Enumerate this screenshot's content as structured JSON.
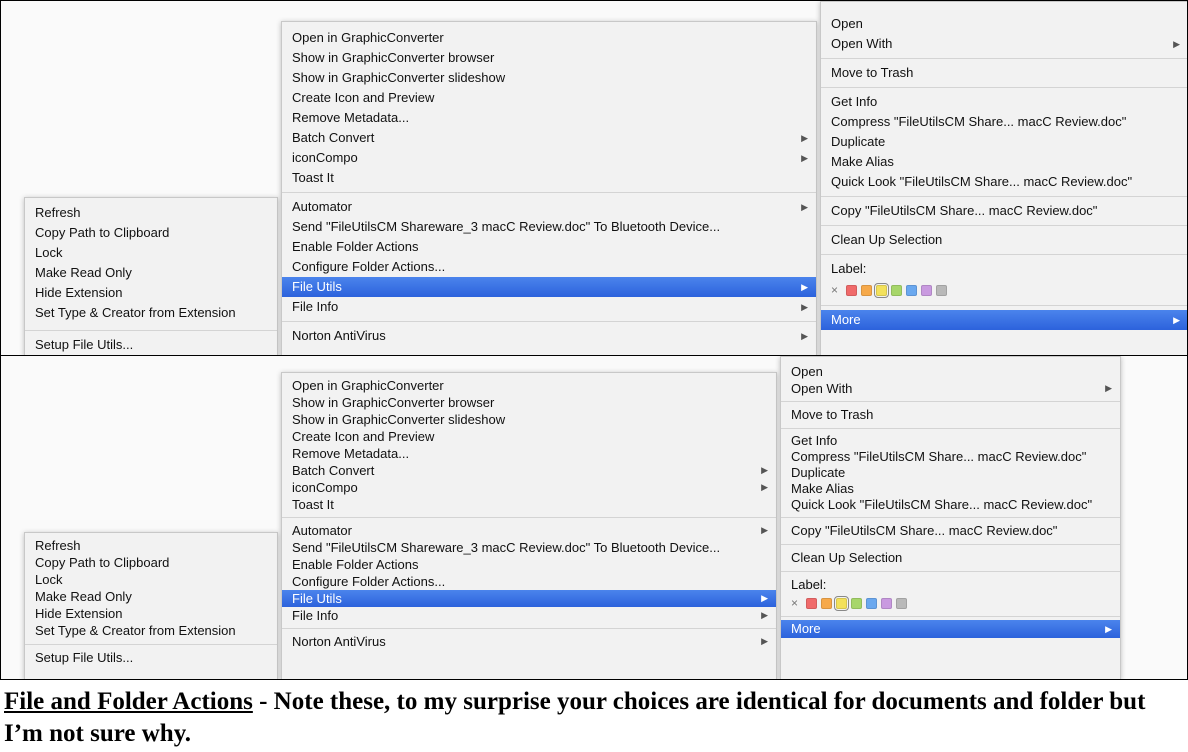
{
  "col1": {
    "items": [
      {
        "label": "Refresh"
      },
      {
        "label": "Copy Path to Clipboard"
      },
      {
        "label": "Lock"
      },
      {
        "label": "Make Read Only"
      },
      {
        "label": "Hide Extension"
      },
      {
        "label": "Set Type & Creator from Extension"
      }
    ],
    "setup": "Setup File Utils..."
  },
  "col2": {
    "group1": [
      {
        "label": "Open in GraphicConverter",
        "arrow": false
      },
      {
        "label": "Show in GraphicConverter browser",
        "arrow": false
      },
      {
        "label": "Show in GraphicConverter slideshow",
        "arrow": false
      },
      {
        "label": "Create Icon and Preview",
        "arrow": false
      },
      {
        "label": "Remove Metadata...",
        "arrow": false
      },
      {
        "label": "Batch Convert",
        "arrow": true
      },
      {
        "label": "iconCompo",
        "arrow": true
      },
      {
        "label": "Toast It",
        "arrow": false
      }
    ],
    "group2": [
      {
        "label": "Automator",
        "arrow": true
      },
      {
        "label": "Send \"FileUtilsCM Shareware_3 macC Review.doc\" To Bluetooth Device...",
        "arrow": false
      },
      {
        "label": "Enable Folder Actions",
        "arrow": false
      },
      {
        "label": "Configure Folder Actions...",
        "arrow": false
      },
      {
        "label": "File Utils",
        "arrow": true,
        "selected": true
      },
      {
        "label": "File Info",
        "arrow": true
      }
    ],
    "group3": [
      {
        "label": "Norton AntiVirus",
        "arrow": true
      }
    ]
  },
  "col3": {
    "open": "Open",
    "open_with": "Open With",
    "move_to_trash": "Move to Trash",
    "info_group": [
      "Get Info",
      "Compress \"FileUtilsCM Share... macC Review.doc\"",
      "Duplicate",
      "Make Alias",
      "Quick Look \"FileUtilsCM Share... macC Review.doc\""
    ],
    "copy": "Copy \"FileUtilsCM Share... macC Review.doc\"",
    "clean_up": "Clean Up Selection",
    "label_title": "Label:",
    "label_clear": "×",
    "label_colors": [
      "#f06a6a",
      "#f6a94a",
      "#f3e15b",
      "#a7d66a",
      "#6aa8ef",
      "#c99ae0",
      "#b9b9b9"
    ],
    "label_picked": 2,
    "more": "More"
  },
  "arrow_glyph": "▶",
  "caption": {
    "underlined": "File and Folder Actions",
    "rest": " - Note these, to my surprise your choices are identical for documents and folder but I’m not sure why."
  },
  "colors": {
    "selection": "#2f66df",
    "menu_bg": "#f2f2f2",
    "separator": "#d4d4d4"
  }
}
